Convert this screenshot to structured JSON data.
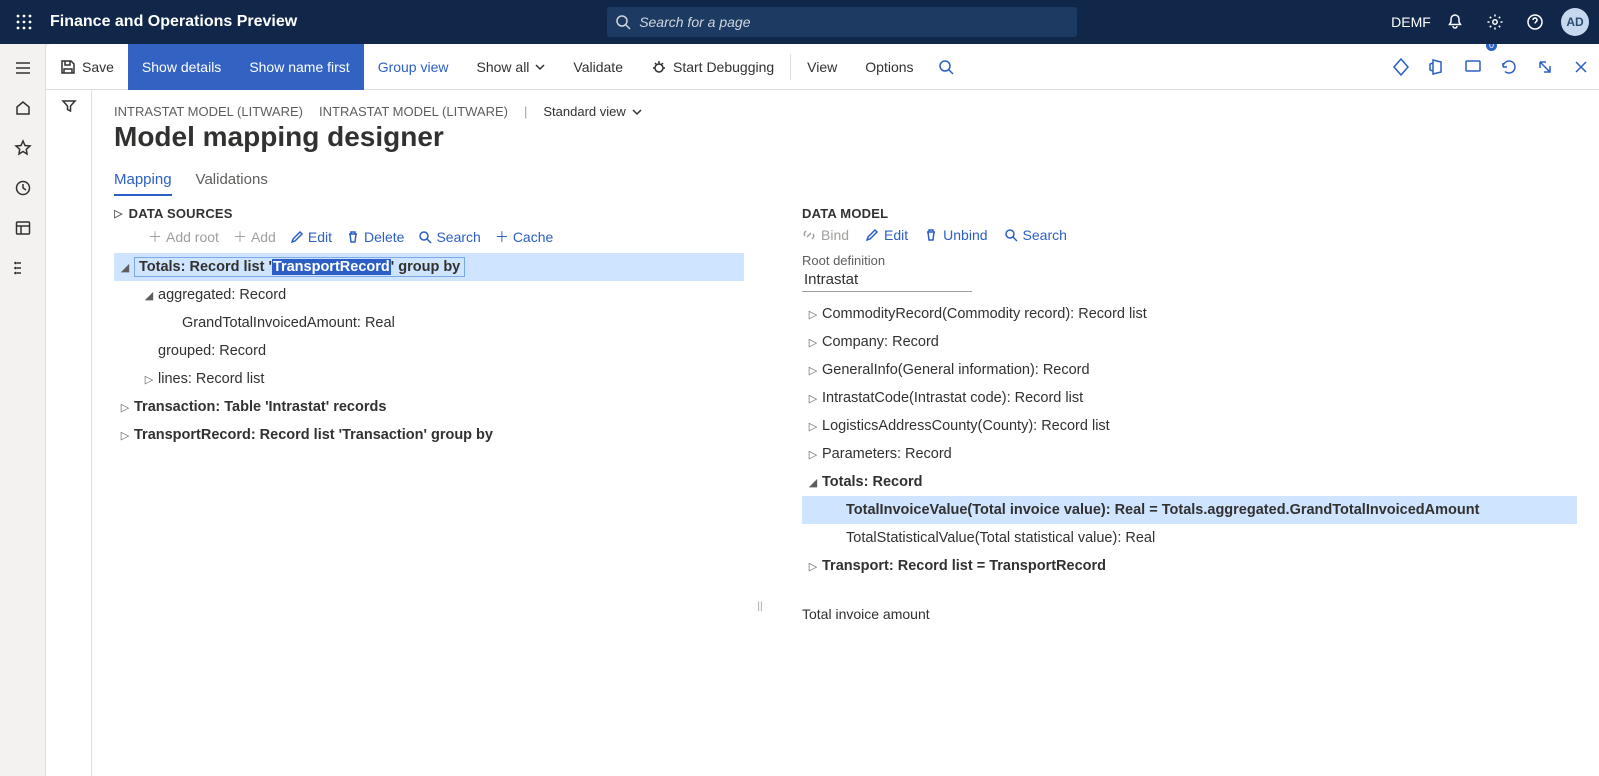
{
  "topbar": {
    "app_title": "Finance and Operations Preview",
    "search_placeholder": "Search for a page",
    "company": "DEMF",
    "avatar": "AD"
  },
  "actionbar": {
    "save": "Save",
    "show_details": "Show details",
    "show_name_first": "Show name first",
    "group_view": "Group view",
    "show_all": "Show all",
    "validate": "Validate",
    "start_debugging": "Start Debugging",
    "view": "View",
    "options": "Options",
    "badge_count": "0"
  },
  "crumb": {
    "path1": "INTRASTAT MODEL (LITWARE)",
    "path2": "INTRASTAT MODEL (LITWARE)",
    "view_name": "Standard view"
  },
  "page_title": "Model mapping designer",
  "tabs": {
    "mapping": "Mapping",
    "validations": "Validations"
  },
  "ds": {
    "header": "DATA SOURCES",
    "toolbar": {
      "add_root": "Add root",
      "add": "Add",
      "edit": "Edit",
      "delete": "Delete",
      "search": "Search",
      "cache": "Cache"
    },
    "tree": {
      "totals_prefix": "Totals: Record list '",
      "totals_hl": "TransportRecord",
      "totals_suffix": "' group by",
      "aggregated": "aggregated: Record",
      "grand_total": "GrandTotalInvoicedAmount: Real",
      "grouped": "grouped: Record",
      "lines": "lines: Record list",
      "transaction": "Transaction: Table 'Intrastat' records",
      "transport_record": "TransportRecord: Record list 'Transaction' group by"
    }
  },
  "dm": {
    "header": "DATA MODEL",
    "toolbar": {
      "bind": "Bind",
      "edit": "Edit",
      "unbind": "Unbind",
      "search": "Search"
    },
    "root_label": "Root definition",
    "root_value": "Intrastat",
    "tree": {
      "commodity": "CommodityRecord(Commodity record): Record list",
      "company": "Company: Record",
      "general": "GeneralInfo(General information): Record",
      "intrastat_code": "IntrastatCode(Intrastat code): Record list",
      "logistics": "LogisticsAddressCounty(County): Record list",
      "parameters": "Parameters: Record",
      "totals": "Totals: Record",
      "total_invoice": "TotalInvoiceValue(Total invoice value): Real = Totals.aggregated.GrandTotalInvoicedAmount",
      "total_stat": "TotalStatisticalValue(Total statistical value): Real",
      "transport": "Transport: Record list = TransportRecord"
    },
    "footer": "Total invoice amount"
  }
}
